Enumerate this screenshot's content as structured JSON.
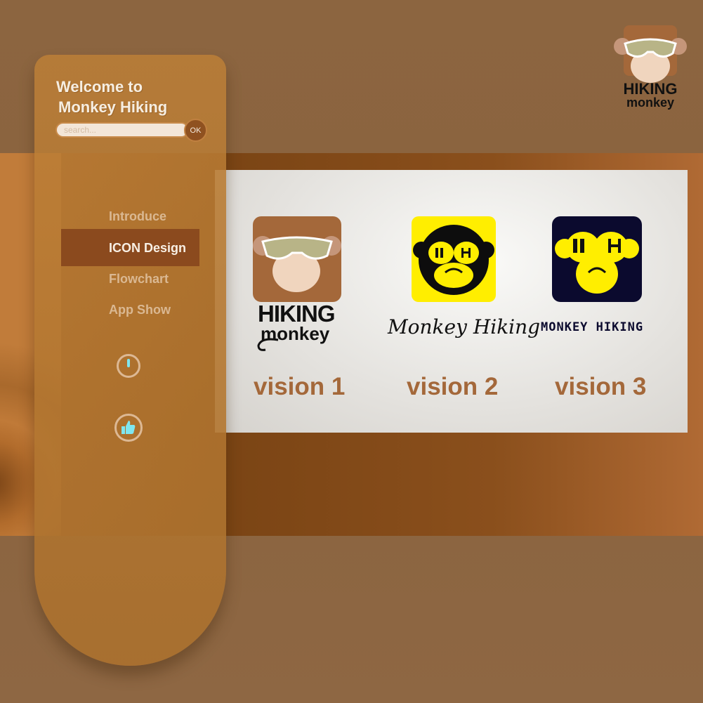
{
  "brand": {
    "logo_line1": "HIKING",
    "logo_line2": "monkey"
  },
  "sidebar": {
    "welcome_line1": "Welcome to",
    "welcome_line2": "Monkey Hiking",
    "search_placeholder": "search...",
    "search_button": "OK",
    "nav": [
      {
        "label": "Introduce",
        "active": false
      },
      {
        "label": "ICON Design",
        "active": true
      },
      {
        "label": "Flowchart",
        "active": false
      },
      {
        "label": "App Show",
        "active": false
      }
    ],
    "icons": [
      "power-icon",
      "thumbs-up-icon"
    ]
  },
  "main": {
    "versions": [
      {
        "label": "vision 1",
        "wordmark_line1": "HIKING",
        "wordmark_line2": "monkey"
      },
      {
        "label": "vision 2",
        "wordmark": "Monkey Hiking"
      },
      {
        "label": "vision 3",
        "wordmark": "MONKEY HIKING"
      }
    ],
    "face_letters": "H"
  },
  "colors": {
    "accent_brown": "#8b4a1e",
    "label_brown": "#a4683a",
    "yellow": "#ffee00",
    "navy": "#0b0a2e"
  }
}
